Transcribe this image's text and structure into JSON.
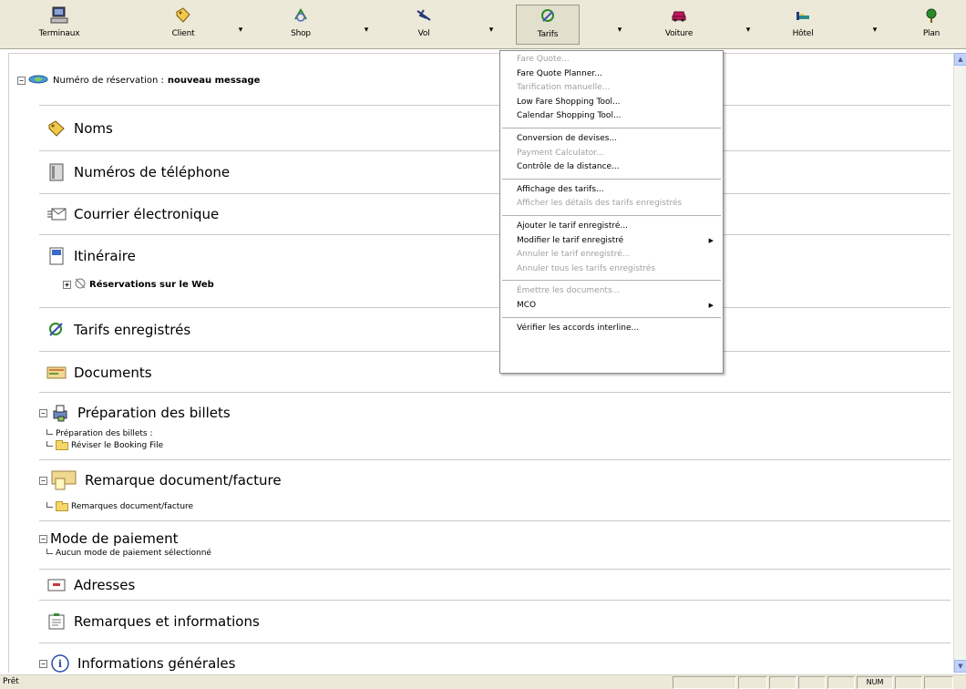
{
  "toolbar": {
    "buttons": [
      {
        "label": "Terminaux",
        "icon": "terminal-icon"
      },
      {
        "label": "Client",
        "icon": "tag-icon"
      },
      {
        "label": "Shop",
        "icon": "shop-icon"
      },
      {
        "label": "Vol",
        "icon": "airplane-icon"
      },
      {
        "label": "Tarifs",
        "icon": "fares-icon"
      },
      {
        "label": "Voiture",
        "icon": "car-icon"
      },
      {
        "label": "Hôtel",
        "icon": "hotel-bed-icon"
      },
      {
        "label": "Plan",
        "icon": "map-pin-icon"
      }
    ]
  },
  "booking": {
    "label": "Numéro de réservation :",
    "value": "nouveau message"
  },
  "sections": {
    "names": "Noms",
    "phones": "Numéros de téléphone",
    "email": "Courrier électronique",
    "itinerary": "Itinéraire",
    "web_reservations": "Réservations sur le Web",
    "stored_fares": "Tarifs enregistrés",
    "documents": "Documents",
    "ticket_prep": "Préparation des billets",
    "ticket_prep_line": "Préparation des billets :",
    "ticket_prep_folder": "Réviser le Booking File",
    "doc_remark": "Remarque document/facture",
    "doc_remark_folder": "Remarques document/facture",
    "payment": "Mode de paiement",
    "payment_line": "Aucun mode de paiement sélectionné",
    "addresses": "Adresses",
    "remarks": "Remarques et informations",
    "general": "Informations générales"
  },
  "menu": {
    "items": [
      {
        "label": "Fare Quote...",
        "disabled": true
      },
      {
        "label": "Fare Quote Planner...",
        "disabled": false
      },
      {
        "label": "Tarification manuelle...",
        "disabled": true
      },
      {
        "label": "Low Fare Shopping Tool...",
        "disabled": false
      },
      {
        "label": "Calendar Shopping Tool...",
        "disabled": false
      },
      {
        "sep": true
      },
      {
        "label": "Conversion de devises...",
        "disabled": false
      },
      {
        "label": "Payment Calculator...",
        "disabled": true
      },
      {
        "label": "Contrôle de la distance...",
        "disabled": false
      },
      {
        "sep": true
      },
      {
        "label": "Affichage des tarifs...",
        "disabled": false
      },
      {
        "label": "Afficher les détails des tarifs enregistrés",
        "disabled": true
      },
      {
        "sep": true
      },
      {
        "label": "Ajouter le tarif enregistré...",
        "disabled": false
      },
      {
        "label": "Modifier le tarif enregistré",
        "disabled": false,
        "submenu": true
      },
      {
        "label": "Annuler le tarif enregistré...",
        "disabled": true
      },
      {
        "label": "Annuler tous les tarifs enregistrés",
        "disabled": true
      },
      {
        "sep": true
      },
      {
        "label": "Émettre les documents...",
        "disabled": true
      },
      {
        "label": "MCO",
        "disabled": false,
        "submenu": true
      },
      {
        "sep": true
      },
      {
        "label": "Vérifier les accords interline...",
        "disabled": false
      }
    ]
  },
  "statusbar": {
    "text": "Prêt",
    "num": "NUM"
  }
}
